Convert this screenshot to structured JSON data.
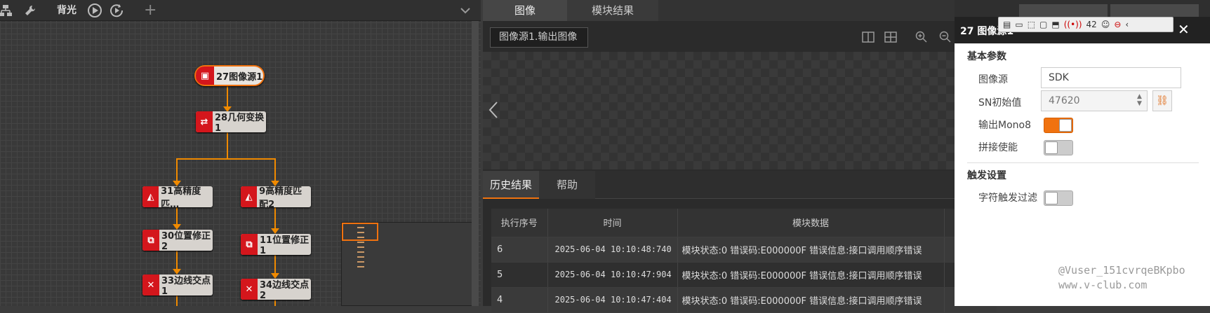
{
  "left_toolbar": {
    "title": "背光",
    "add": "+"
  },
  "nodes": [
    {
      "label": "27图像源1",
      "icon": "image-icon"
    },
    {
      "label": "28几何变换1",
      "icon": "geometry-transform-icon"
    },
    {
      "label": "31高精度匹…",
      "icon": "match-icon"
    },
    {
      "label": "9高精度匹配2",
      "icon": "match-icon"
    },
    {
      "label": "30位置修正2",
      "icon": "position-correct-icon"
    },
    {
      "label": "11位置修正1",
      "icon": "position-correct-icon"
    },
    {
      "label": "33边线交点1",
      "icon": "line-intersect-icon"
    },
    {
      "label": "34边线交点2",
      "icon": "line-intersect-icon"
    }
  ],
  "middle": {
    "tabs": [
      "图像",
      "模块结果"
    ],
    "image_source": "图像源1.输出图像",
    "hist_tabs": [
      "历史结果",
      "帮助"
    ],
    "table": {
      "headers": [
        "执行序号",
        "时间",
        "模块数据"
      ],
      "rows": [
        [
          "6",
          "2025-06-04 10:10:48:740",
          "模块状态:0 错误码:E000000F 错误信息:接口调用顺序错误"
        ],
        [
          "5",
          "2025-06-04 10:10:47:904",
          "模块状态:0 错误码:E000000F 错误信息:接口调用顺序错误"
        ],
        [
          "4",
          "2025-06-04 10:10:47:404",
          "模块状态:0 错误码:E000000F 错误信息:接口调用顺序错误"
        ]
      ]
    }
  },
  "right": {
    "title": "27 图像源1",
    "badge": "42",
    "close": "✕",
    "sec_basic": "基本参数",
    "img_source_label": "图像源",
    "img_source_value": "SDK",
    "sn_label": "SN初始值",
    "sn_value": "47620",
    "mono_label": "输出Mono8",
    "mono_on": true,
    "stitch_label": "拼接使能",
    "stitch_on": false,
    "sec_trigger": "触发设置",
    "char_trigger_label": "字符触发过滤",
    "char_trigger_on": false
  },
  "watermark": {
    "line1": "@Vuser_151cvrqeBKpbo",
    "line2": "www.v-club.com"
  },
  "colors": {
    "accent": "#f0720f",
    "node_icon": "#d4161c"
  }
}
